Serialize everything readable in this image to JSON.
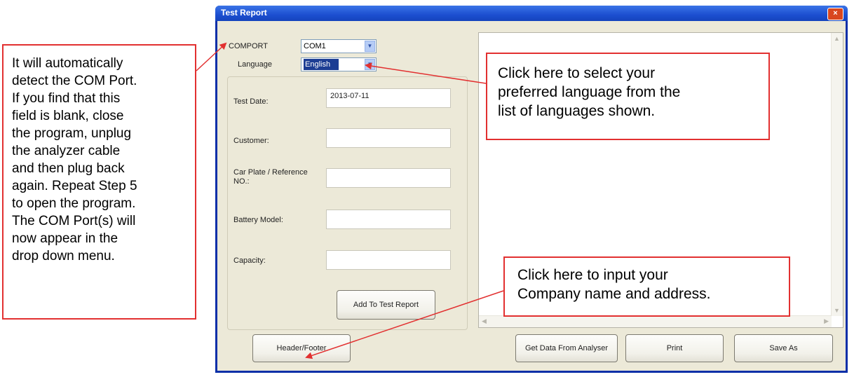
{
  "window": {
    "title": "Test Report",
    "close_label": "×"
  },
  "comport": {
    "label": "COMPORT",
    "value": "COM1"
  },
  "language": {
    "label": "Language",
    "value": "English"
  },
  "form": {
    "test_date_label": "Test Date:",
    "test_date_value": "2013-07-11",
    "customer_label": "Customer:",
    "car_plate_label": "Car Plate / Reference\nNO.:",
    "battery_model_label": "Battery Model:",
    "capacity_label": "Capacity:",
    "add_button": "Add To Test Report"
  },
  "buttons": {
    "header_footer": "Header/Footer",
    "get_data": "Get Data From Analyser",
    "print": "Print",
    "save_as": "Save As"
  },
  "callouts": {
    "left": "It will automatically\ndetect the COM Port.\nIf you find that this\nfield is blank, close\nthe program, unplug\nthe analyzer cable\nand then plug back\nagain. Repeat Step 5\nto open the program.\nThe COM Port(s) will\nnow appear in the\ndrop down menu.",
    "language": "Click here to select your\npreferred language from the\nlist of languages shown.",
    "header": "Click here to input your\nCompany name and address."
  },
  "colors": {
    "callout_border": "#e23030",
    "title_bar": "#1c4fd0",
    "dialog_bg": "#ece9d8"
  }
}
